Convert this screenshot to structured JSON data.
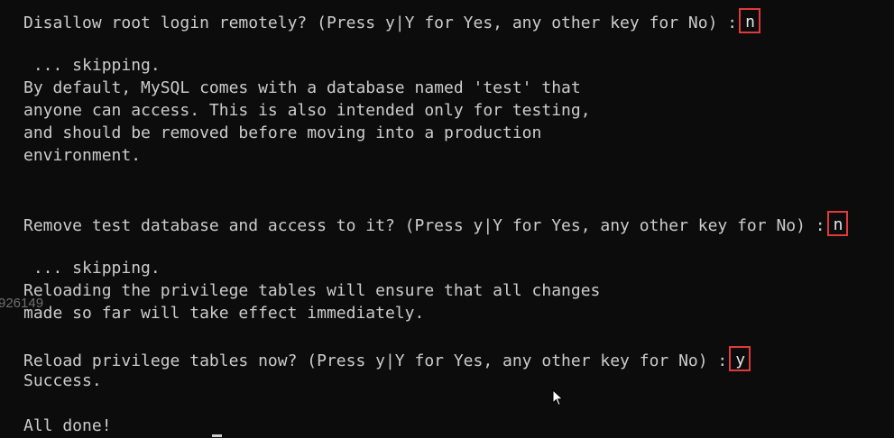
{
  "terminal": {
    "lines": [
      "Disallow root login remotely? (Press y|Y for Yes, any other key for No) :",
      " ... skipping.",
      "By default, MySQL comes with a database named 'test' that",
      "anyone can access. This is also intended only for testing,",
      "and should be removed before moving into a production",
      "environment.",
      "Remove test database and access to it? (Press y|Y for Yes, any other key for No) :",
      " ... skipping.",
      "Reloading the privilege tables will ensure that all changes",
      "made so far will take effect immediately.",
      "Reload privilege tables now? (Press y|Y for Yes, any other key for No) :",
      "Success.",
      "All done!"
    ],
    "answers": {
      "disallow_root": "n",
      "remove_test_db": "n",
      "reload_privileges": "y"
    },
    "watermark": "926149"
  },
  "colors": {
    "background": "#0c0c0c",
    "text": "#cccccc",
    "highlight_box": "#e03a3a"
  },
  "icons": {
    "mouse_pointer": "arrow-cursor-icon"
  }
}
